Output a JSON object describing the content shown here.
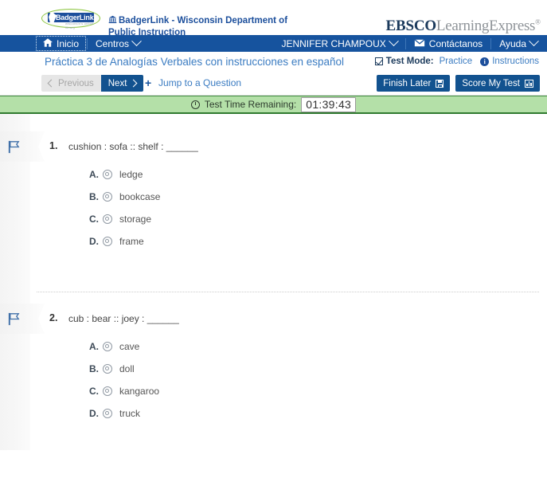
{
  "masthead": {
    "logo_text": "BadgerLink",
    "logo_subtext": "wisconsin's online library",
    "institution": "BadgerLink - Wisconsin Department of Public Instruction",
    "institution_icon": "bank-icon",
    "product_brand_primary": "EBSCO",
    "product_brand_secondary": "LearningExpress",
    "product_brand_mark": "®"
  },
  "nav": {
    "left_items": [
      {
        "label": "Inicio",
        "icon": "home-icon",
        "has_caret": false,
        "focused": true
      },
      {
        "label": "Centros",
        "icon": null,
        "has_caret": true,
        "focused": false
      }
    ],
    "right_items": [
      {
        "label": "JENNIFER CHAMPOUX",
        "icon": null,
        "has_caret": true
      },
      {
        "label": "Contáctanos",
        "icon": "envelope-icon",
        "has_caret": false
      },
      {
        "label": "Ayuda",
        "icon": null,
        "has_caret": true
      }
    ]
  },
  "title_row": {
    "title": "Práctica 3 de Analogías Verbales con instrucciones en español",
    "test_mode_label": "Test Mode:",
    "test_mode_value": "Practice",
    "test_mode_icon": "checkbox-checked-icon",
    "instructions_label": "Instructions",
    "instructions_icon": "info-circle-icon"
  },
  "toolbar": {
    "previous_label": "Previous",
    "previous_disabled": true,
    "next_label": "Next",
    "jump_label": "Jump to a Question",
    "jump_icon": "plus-icon",
    "finish_later_label": "Finish Later",
    "finish_later_icon": "save-icon",
    "score_test_label": "Score My Test",
    "score_test_icon": "bar-chart-icon"
  },
  "timer": {
    "icon": "clock-icon",
    "label": "Test Time Remaining:",
    "value": "01:39:43"
  },
  "questions": [
    {
      "number": "1.",
      "stem": "cushion : sofa :: shelf : ______",
      "flag_icon": "flag-icon",
      "options": [
        {
          "letter": "A.",
          "text": "ledge"
        },
        {
          "letter": "B.",
          "text": "bookcase"
        },
        {
          "letter": "C.",
          "text": "storage"
        },
        {
          "letter": "D.",
          "text": "frame"
        }
      ]
    },
    {
      "number": "2.",
      "stem": "cub : bear :: joey : ______",
      "flag_icon": "flag-icon",
      "options": [
        {
          "letter": "A.",
          "text": "cave"
        },
        {
          "letter": "B.",
          "text": "doll"
        },
        {
          "letter": "C.",
          "text": "kangaroo"
        },
        {
          "letter": "D.",
          "text": "truck"
        }
      ]
    }
  ],
  "colors": {
    "nav_blue": "#16539e",
    "button_blue": "#12528f",
    "link_blue": "#3b7cc2",
    "timer_green": "#b4e0a8",
    "timer_border_green": "#2f7a2f",
    "logo_green": "#8cc63f"
  }
}
